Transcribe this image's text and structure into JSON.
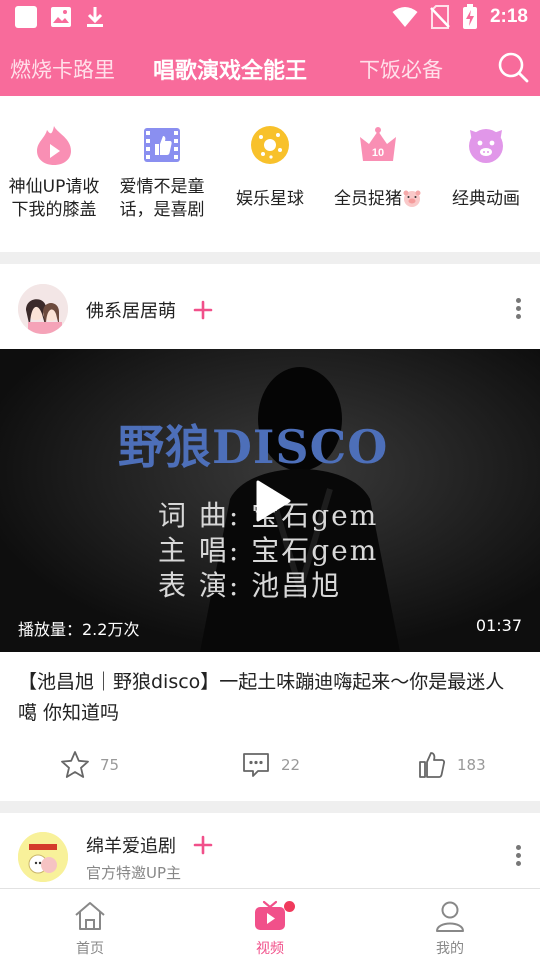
{
  "status_bar": {
    "time": "2:18",
    "left_icons": [
      "app-square-icon",
      "image-icon",
      "download-icon"
    ],
    "right_icons": [
      "wifi-icon",
      "no-sim-icon",
      "battery-charging-icon"
    ]
  },
  "top_nav": {
    "tabs": [
      {
        "label": "燃烧卡路里",
        "active": false
      },
      {
        "label": "唱歌演戏全能王",
        "active": true
      },
      {
        "label": "下饭必备",
        "active": false
      }
    ],
    "search_icon": "search-icon"
  },
  "categories": [
    {
      "label": "神仙UP请收下我的膝盖",
      "line1": "神仙UP请收",
      "line2": "下我的膝盖",
      "icon": "flame-play-icon"
    },
    {
      "label": "爱情不是童话，是喜剧",
      "line1": "爱情不是童",
      "line2": "话，是喜剧",
      "icon": "film-thumbs-up-icon"
    },
    {
      "label": "娱乐星球",
      "line1": "娱乐星球",
      "icon": "donut-icon"
    },
    {
      "label": "全员捉猪",
      "line1": "全员捉猪",
      "icon": "crown-icon",
      "extra_icon": "pig-emoji-icon"
    },
    {
      "label": "经典动画",
      "line1": "经典动画",
      "icon": "cartoon-face-icon"
    }
  ],
  "posts": [
    {
      "author": "佛系居居萌",
      "avatar": "avatar-couple-illustration",
      "video": {
        "title": "野狼DISCO",
        "credits": [
          "词 曲: 宝石gem",
          "主 唱: 宝石gem",
          "表 演: 池昌旭"
        ],
        "views": "播放量：2.2万次",
        "duration": "01:37"
      },
      "text": "【池昌旭｜野狼disco】一起土味蹦迪嗨起来～你是最迷人噶 你知道吗",
      "actions": {
        "favorites": "75",
        "comments": "22",
        "likes": "183"
      }
    },
    {
      "author": "绵羊爱追剧",
      "subtitle": "官方特邀UP主",
      "avatar": "avatar-sheep-logo"
    }
  ],
  "bottom_nav": [
    {
      "label": "首页",
      "icon": "home-icon",
      "active": false
    },
    {
      "label": "视频",
      "icon": "tv-video-icon",
      "active": true,
      "badge": true
    },
    {
      "label": "我的",
      "icon": "person-icon",
      "active": false
    }
  ],
  "colors": {
    "brand_pink": "#f86b9b",
    "active_pink": "#f1508a",
    "badge_red": "#f03a5c",
    "video_title_blue": "#4d6fb9"
  }
}
